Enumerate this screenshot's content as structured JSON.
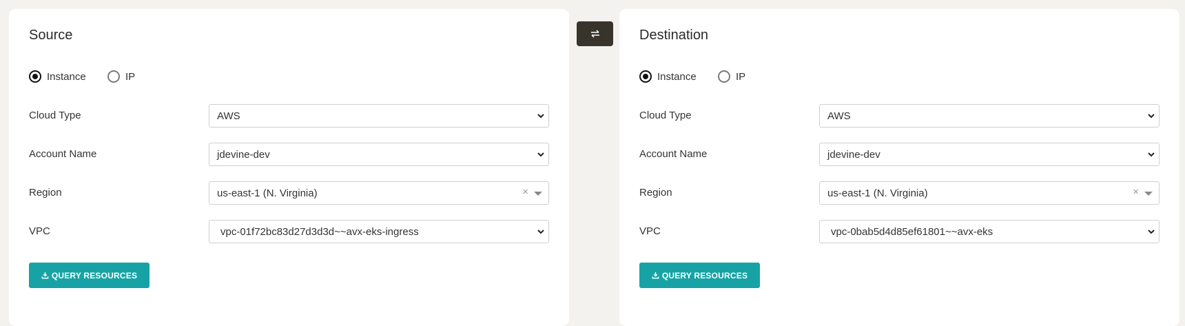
{
  "swap": {
    "icon": "swap-arrows-icon"
  },
  "source": {
    "title": "Source",
    "radios": {
      "instance_label": "Instance",
      "ip_label": "IP",
      "selected": "Instance"
    },
    "cloud_type": {
      "label": "Cloud Type",
      "value": "AWS"
    },
    "account_name": {
      "label": "Account Name",
      "value": "jdevine-dev"
    },
    "region": {
      "label": "Region",
      "value": "us-east-1 (N. Virginia)",
      "clear": "×"
    },
    "vpc": {
      "label": "VPC",
      "value": "vpc-01f72bc83d27d3d3d~~avx-eks-ingress"
    },
    "query_button": {
      "label": "QUERY RESOURCES"
    }
  },
  "destination": {
    "title": "Destination",
    "radios": {
      "instance_label": "Instance",
      "ip_label": "IP",
      "selected": "Instance"
    },
    "cloud_type": {
      "label": "Cloud Type",
      "value": "AWS"
    },
    "account_name": {
      "label": "Account Name",
      "value": "jdevine-dev"
    },
    "region": {
      "label": "Region",
      "value": "us-east-1 (N. Virginia)",
      "clear": "×"
    },
    "vpc": {
      "label": "VPC",
      "value": "vpc-0bab5d4d85ef61801~~avx-eks"
    },
    "query_button": {
      "label": "QUERY RESOURCES"
    }
  },
  "colors": {
    "accent": "#17a3a6",
    "swap_bg": "#38332b",
    "page_bg": "#f3f2ef"
  }
}
